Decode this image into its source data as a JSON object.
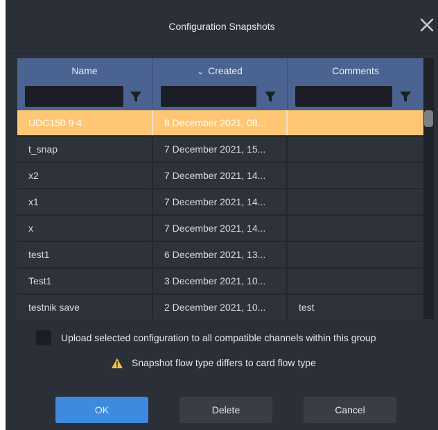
{
  "dialog": {
    "title": "Configuration Snapshots",
    "close_icon": "close-icon"
  },
  "table": {
    "columns": [
      {
        "label": "Name"
      },
      {
        "label": "Created",
        "sort_icon": "chevron-down-icon",
        "sort_glyph": "⌄"
      },
      {
        "label": "Comments"
      }
    ],
    "filter_icon": "filter-icon",
    "rows": [
      {
        "name": "UDC150 9 4",
        "created": "8 December 2021, 08...",
        "comments": "",
        "selected": true
      },
      {
        "name": "t_snap",
        "created": "7 December 2021, 15...",
        "comments": ""
      },
      {
        "name": "x2",
        "created": "7 December 2021, 14...",
        "comments": ""
      },
      {
        "name": "x1",
        "created": "7 December 2021, 14...",
        "comments": ""
      },
      {
        "name": "x",
        "created": "7 December 2021, 14...",
        "comments": ""
      },
      {
        "name": "test1",
        "created": "6 December 2021, 13...",
        "comments": ""
      },
      {
        "name": "Test1",
        "created": "3 December 2021, 10...",
        "comments": ""
      },
      {
        "name": "testnik save",
        "created": "2 December 2021, 10...",
        "comments": "test"
      }
    ]
  },
  "upload_checkbox": {
    "label": "Upload selected configuration to all compatible channels within this group",
    "checked": false
  },
  "warning": {
    "icon": "warning-icon",
    "text": "Snapshot flow type differs to card flow type"
  },
  "buttons": {
    "ok": "OK",
    "delete": "Delete",
    "cancel": "Cancel"
  },
  "colors": {
    "background": "#2b2f37",
    "header": "#4a6390",
    "row": "#2e323a",
    "selected_row": "#ffc675",
    "primary_button": "#3d8ae0",
    "warning": "#f0c04a"
  }
}
